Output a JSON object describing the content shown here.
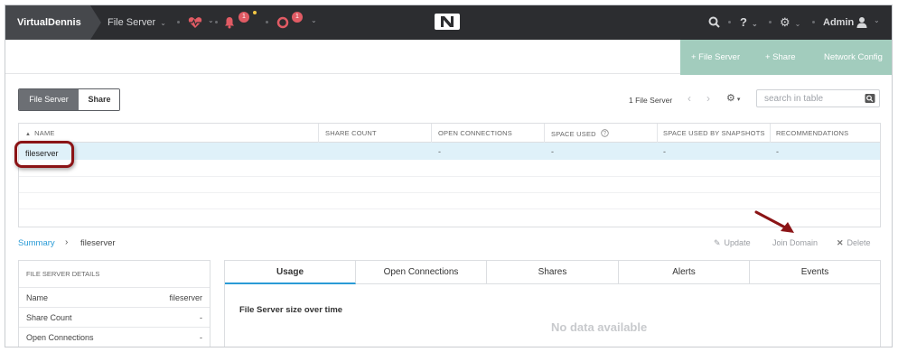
{
  "header": {
    "cluster_name": "VirtualDennis",
    "entity_menu": "File Server",
    "alerts_count": "1",
    "tasks_count": "1",
    "help_label": "?",
    "user_label": "Admin"
  },
  "action_bar": {
    "new_file_server": "+ File Server",
    "new_share": "+ Share",
    "network_config": "Network Config"
  },
  "entity_toggle": {
    "file_server": "File Server",
    "share": "Share"
  },
  "table_toolbar": {
    "count_label": "1 File Server",
    "search_placeholder": "search in table"
  },
  "table": {
    "columns": [
      "NAME",
      "SHARE COUNT",
      "OPEN CONNECTIONS",
      "SPACE USED",
      "SPACE USED BY SNAPSHOTS",
      "RECOMMENDATIONS"
    ],
    "sort_indicator": "▲",
    "rows": [
      {
        "name": "fileserver",
        "share_count": "",
        "open_connections": "-",
        "space_used": "-",
        "space_used_snapshots": "-",
        "recommendations": "-"
      }
    ]
  },
  "summary": {
    "link": "Summary",
    "separator": "›",
    "entity": "fileserver",
    "update": "Update",
    "join_domain": "Join Domain",
    "delete": "Delete"
  },
  "details": {
    "header": "FILE SERVER DETAILS",
    "rows": [
      {
        "key": "Name",
        "value": "fileserver"
      },
      {
        "key": "Share Count",
        "value": "-"
      },
      {
        "key": "Open Connections",
        "value": "-"
      }
    ]
  },
  "tabs": {
    "items": [
      "Usage",
      "Open Connections",
      "Shares",
      "Alerts",
      "Events"
    ],
    "active": "Usage",
    "chart_title": "File Server size over time",
    "empty_text": "No data available"
  },
  "colors": {
    "topbar": "#2c2d30",
    "action_bar": "#a2ccbd",
    "selected_row": "#dff1f9",
    "link": "#2a9bd6",
    "callout": "#8b1416",
    "alert_badge": "#e15b64"
  }
}
